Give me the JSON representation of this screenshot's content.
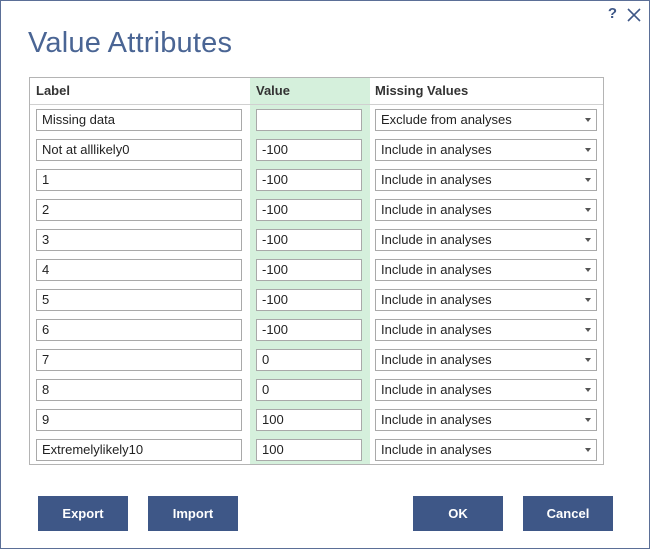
{
  "dialog": {
    "title": "Value Attributes",
    "help_label": "?"
  },
  "grid": {
    "headers": {
      "label": "Label",
      "value": "Value",
      "missing": "Missing Values"
    },
    "rows": [
      {
        "label": "Missing data",
        "value": "",
        "missing": "Exclude from analyses"
      },
      {
        "label": "Not at alllikely0",
        "value": "-100",
        "missing": "Include in analyses"
      },
      {
        "label": "1",
        "value": "-100",
        "missing": "Include in analyses"
      },
      {
        "label": "2",
        "value": "-100",
        "missing": "Include in analyses"
      },
      {
        "label": "3",
        "value": "-100",
        "missing": "Include in analyses"
      },
      {
        "label": "4",
        "value": "-100",
        "missing": "Include in analyses"
      },
      {
        "label": "5",
        "value": "-100",
        "missing": "Include in analyses"
      },
      {
        "label": "6",
        "value": "-100",
        "missing": "Include in analyses"
      },
      {
        "label": "7",
        "value": "0",
        "missing": "Include in analyses"
      },
      {
        "label": "8",
        "value": "0",
        "missing": "Include in analyses"
      },
      {
        "label": "9",
        "value": "100",
        "missing": "Include in analyses"
      },
      {
        "label": "Extremelylikely10",
        "value": "100",
        "missing": "Include in analyses"
      }
    ]
  },
  "buttons": {
    "export": "Export",
    "import": "Import",
    "ok": "OK",
    "cancel": "Cancel"
  },
  "colors": {
    "accent": "#3e5787",
    "value_column": "#d5f0dc",
    "title": "#4a6594"
  },
  "icons": [
    "help-icon",
    "close-icon",
    "chevron-down-icon"
  ]
}
